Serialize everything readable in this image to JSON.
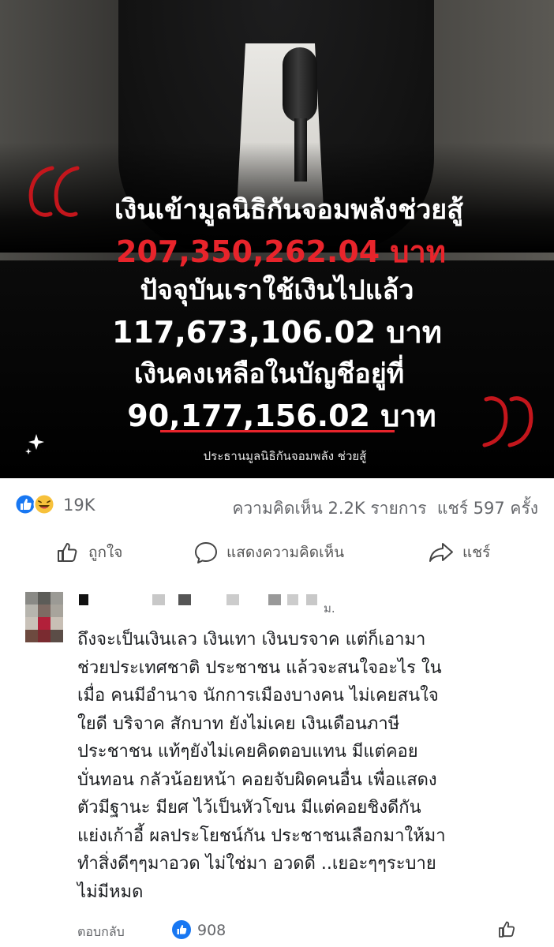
{
  "post_image": {
    "line1": "เงินเข้ามูลนิธิกันจอมพลังช่วยสู้",
    "line2": "207,350,262.04 บาท",
    "line3": "ปัจจุบันเราใช้เงินไปแล้ว",
    "line4": "117,673,106.02 บาท",
    "line5": "เงินคงเหลือในบัญชีอยู่ที่",
    "line6": "90,177,156.02 บาท",
    "credit": "ประธานมูลนิธิกันจอมพลัง ช่วยสู้",
    "accent_color": "#e8242b"
  },
  "reactions": {
    "icons": [
      "like-icon",
      "haha-icon"
    ],
    "count": "19K",
    "comments_label": "ความคิดเห็น 2.2K รายการ",
    "shares_label": "แชร์ 597 ครั้ง"
  },
  "actions": {
    "like_label": "ถูกใจ",
    "comment_label": "แสดงความคิดเห็น",
    "share_label": "แชร์"
  },
  "comment": {
    "time_fragment": "ม.",
    "text": "ถึงจะเป็นเงินเลว เงินเทา เงินบรจาค แต่ก็เอามา\nช่วยประเทศชาติ ประชาชน แล้วจะสนใจอะไร ใน\nเมื่อ คนมีอำนาจ นักการเมืองบางคน ไม่เคยสนใจ\nใยดี บริจาค สักบาท ยังไม่เคย เงินเดือนภาษี\nประชาชน แท้ๆยังไม่เคยคิดตอบแทน มีแต่คอย\nบั่นทอน กลัวน้อยหน้า คอยจับผิดคนอื่น เพื่อแสดง\nตัวมีฐานะ มียศ ไว้เป็นหัวโขน  มีแต่คอยชิงดีกัน\nแย่งเก้าอี้ ผลประโยชน์กัน ประชาชนเลือกมาให้มา\nทำสิ่งดีๆๆมาอวด ไม่ใช่มา อวดดี  ..เยอะๆๆระบาย\nไม่มีหมด",
    "reply_label": "ตอบกลับ",
    "like_count": "908"
  },
  "colors": {
    "facebook_blue": "#1877f2",
    "muted_text": "#65676b"
  }
}
